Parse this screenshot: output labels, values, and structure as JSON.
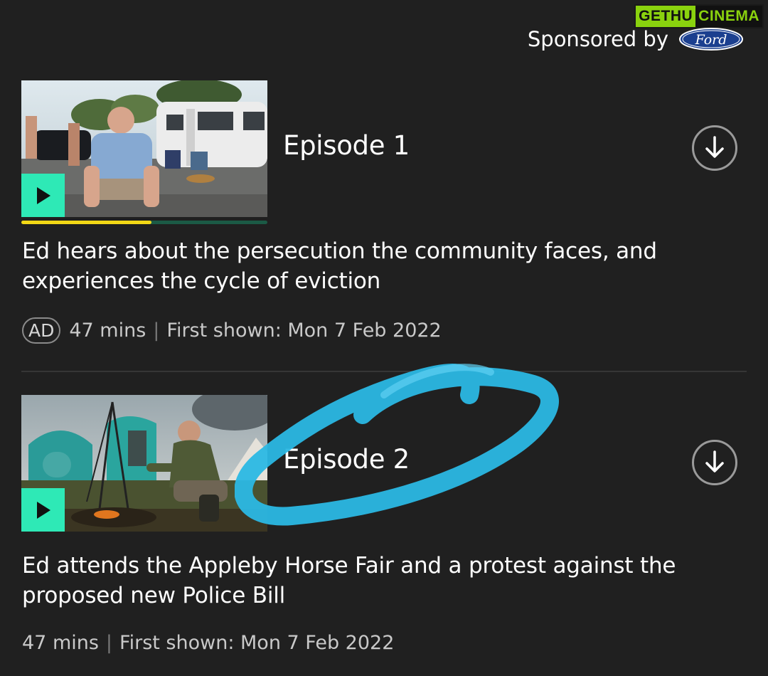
{
  "watermark": {
    "part_a": "GETHU",
    "part_b": "CINEMA"
  },
  "sponsor": {
    "label": "Sponsored by",
    "brand": "Ford"
  },
  "colors": {
    "background": "#202020",
    "play_accent": "#2ee9b6",
    "progress_fill": "#f2d816",
    "scribble": "#2bb8e4"
  },
  "episodes": [
    {
      "title": "Episode 1",
      "description": "Ed hears about the persecution the community faces, and experiences the cycle of eviction",
      "audio_description_badge": "AD",
      "duration": "47 mins",
      "separator": "|",
      "first_shown": "First shown: Mon 7 Feb 2022",
      "watch_progress": 0.53,
      "play_icon": "play-icon",
      "download_icon": "download-icon"
    },
    {
      "title": "Episode 2",
      "description": "Ed attends the Appleby Horse Fair and a protest against the proposed new Police Bill",
      "duration": "47 mins",
      "separator": "|",
      "first_shown": "First shown: Mon 7 Feb 2022",
      "play_icon": "play-icon",
      "download_icon": "download-icon"
    }
  ]
}
